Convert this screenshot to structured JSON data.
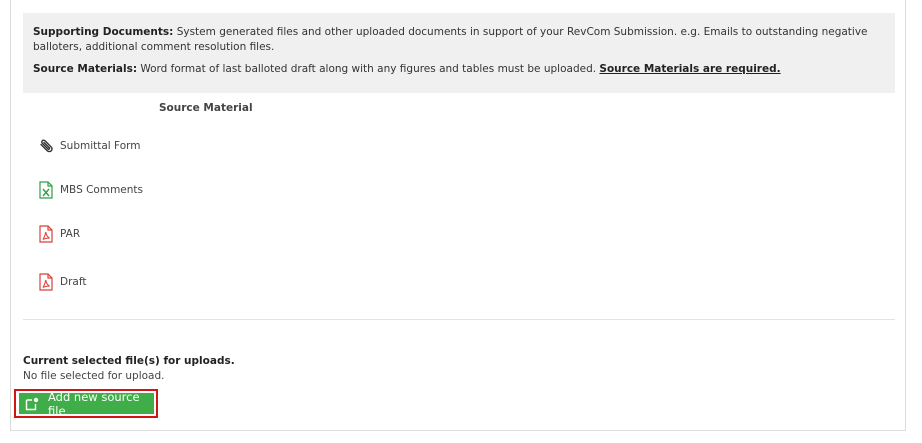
{
  "info": {
    "supporting_label": "Supporting Documents:",
    "supporting_text": " System generated files and other uploaded documents in support of your RevCom Submission. e.g. Emails to outstanding negative balloters, additional comment resolution files.",
    "source_label": "Source Materials:",
    "source_text": " Word format of last balloted draft along with any figures and tables must be uploaded. ",
    "source_required": "Source Materials are required."
  },
  "table": {
    "header": "Source Material",
    "rows": [
      {
        "label": "Submittal Form",
        "icon": "paperclip-icon"
      },
      {
        "label": "MBS Comments",
        "icon": "excel-file-icon"
      },
      {
        "label": "PAR",
        "icon": "pdf-file-icon"
      },
      {
        "label": "Draft",
        "icon": "pdf-file-icon"
      }
    ]
  },
  "upload": {
    "current_label": "Current selected file(s) for uploads.",
    "no_file_text": "No file selected for upload.",
    "add_button_label": "Add new source file"
  },
  "colors": {
    "button_green": "#3fae49",
    "highlight_red": "#d11414",
    "excel_green": "#2e9e45",
    "pdf_red": "#d9403a"
  }
}
